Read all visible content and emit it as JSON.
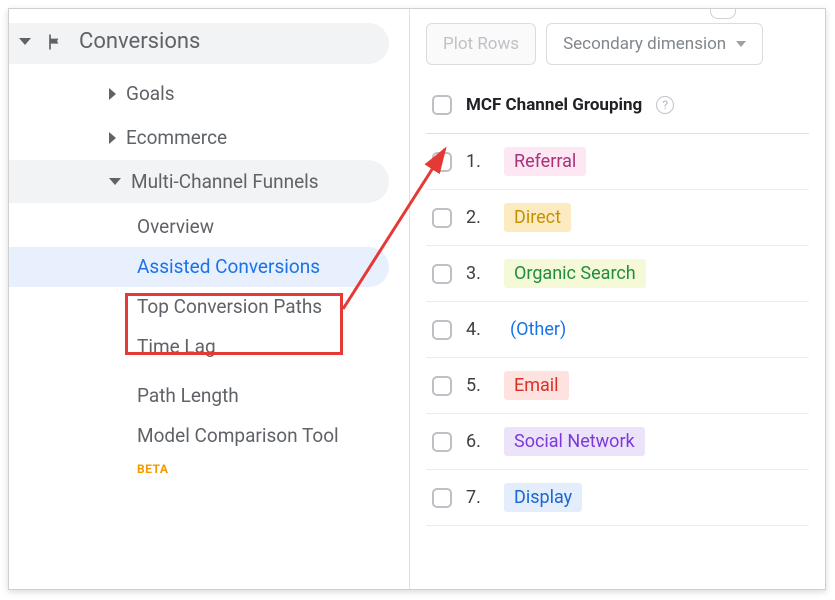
{
  "sidebar": {
    "header": "Conversions",
    "groups": [
      {
        "label": "Goals",
        "type": "collapsed"
      },
      {
        "label": "Ecommerce",
        "type": "collapsed"
      },
      {
        "label": "Multi-Channel Funnels",
        "type": "expanded"
      }
    ],
    "funnel_items": [
      {
        "label": "Overview",
        "active": false
      },
      {
        "label": "Assisted Conversions",
        "active": true
      },
      {
        "label": "Top Conversion Paths",
        "active": false
      },
      {
        "label": "Time Lag",
        "active": false
      },
      {
        "label": "Path Length",
        "active": false
      },
      {
        "label": "Model Comparison Tool",
        "active": false
      }
    ],
    "beta_tag": "BETA"
  },
  "toolbar": {
    "plot_rows": "Plot Rows",
    "secondary_dim": "Secondary dimension"
  },
  "table": {
    "header": "MCF Channel Grouping",
    "rows": [
      {
        "n": "1.",
        "label": "Referral",
        "cls": "referral"
      },
      {
        "n": "2.",
        "label": "Direct",
        "cls": "direct"
      },
      {
        "n": "3.",
        "label": "Organic Search",
        "cls": "organic"
      },
      {
        "n": "4.",
        "label": "(Other)",
        "cls": "other"
      },
      {
        "n": "5.",
        "label": "Email",
        "cls": "email"
      },
      {
        "n": "6.",
        "label": "Social Network",
        "cls": "social"
      },
      {
        "n": "7.",
        "label": "Display",
        "cls": "display"
      }
    ]
  },
  "annotation": {
    "highlight": "Assisted Conversions"
  }
}
